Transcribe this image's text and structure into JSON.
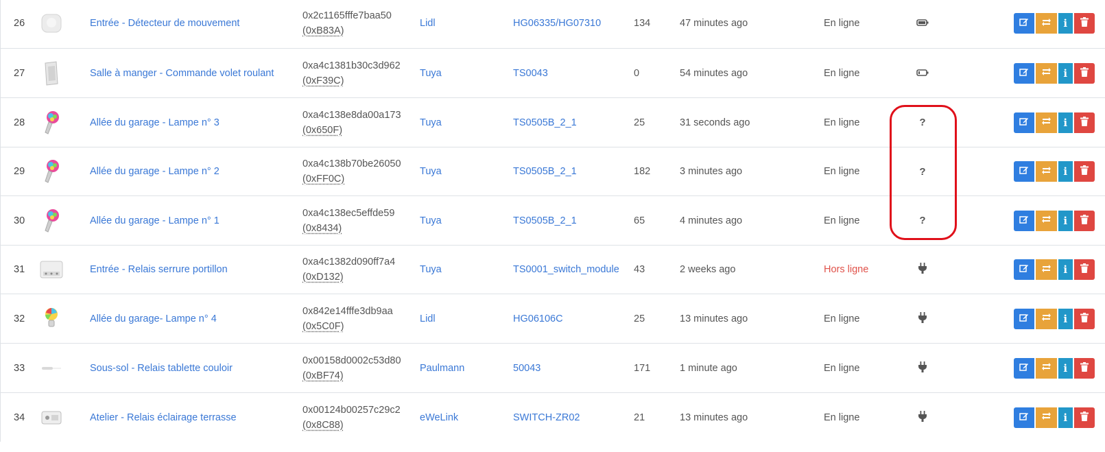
{
  "devices": [
    {
      "num": "26",
      "image": "motion-sensor-image",
      "name": "Entrée - Détecteur de mouvement",
      "ieee": "0x2c1165fffe7baa50",
      "nwk": "(0xB83A)",
      "manufacturer": "Lidl",
      "model": "HG06335/HG07310",
      "lqi": "134",
      "last_seen": "47 minutes ago",
      "availability": "En ligne",
      "power": "battery-icon"
    },
    {
      "num": "27",
      "image": "shutter-switch-image",
      "name": "Salle à manger - Commande volet roulant",
      "ieee": "0xa4c1381b30c3d962",
      "nwk": "(0xF39C)",
      "manufacturer": "Tuya",
      "model": "TS0043",
      "lqi": "0",
      "last_seen": "54 minutes ago",
      "availability": "En ligne",
      "power": "battery-low-icon"
    },
    {
      "num": "28",
      "image": "bulb-image",
      "name": "Allée du garage - Lampe n° 3",
      "ieee": "0xa4c138e8da00a173",
      "nwk": "(0x650F)",
      "manufacturer": "Tuya",
      "model": "TS0505B_2_1",
      "lqi": "25",
      "last_seen": "31 seconds ago",
      "availability": "En ligne",
      "power": "?"
    },
    {
      "num": "29",
      "image": "bulb-image",
      "name": "Allée du garage - Lampe n° 2",
      "ieee": "0xa4c138b70be26050",
      "nwk": "(0xFF0C)",
      "manufacturer": "Tuya",
      "model": "TS0505B_2_1",
      "lqi": "182",
      "last_seen": "3 minutes ago",
      "availability": "En ligne",
      "power": "?"
    },
    {
      "num": "30",
      "image": "bulb-image",
      "name": "Allée du garage - Lampe n° 1",
      "ieee": "0xa4c138ec5effde59",
      "nwk": "(0x8434)",
      "manufacturer": "Tuya",
      "model": "TS0505B_2_1",
      "lqi": "65",
      "last_seen": "4 minutes ago",
      "availability": "En ligne",
      "power": "?"
    },
    {
      "num": "31",
      "image": "relay-module-image",
      "name": "Entrée - Relais serrure portillon",
      "ieee": "0xa4c1382d090ff7a4",
      "nwk": "(0xD132)",
      "manufacturer": "Tuya",
      "model": "TS0001_switch_module",
      "lqi": "43",
      "last_seen": "2 weeks ago",
      "availability": "Hors ligne",
      "power": "plug-icon"
    },
    {
      "num": "32",
      "image": "color-bulb-image",
      "name": "Allée du garage- Lampe n° 4",
      "ieee": "0x842e14fffe3db9aa",
      "nwk": "(0x5C0F)",
      "manufacturer": "Lidl",
      "model": "HG06106C",
      "lqi": "25",
      "last_seen": "13 minutes ago",
      "availability": "En ligne",
      "power": "plug-icon"
    },
    {
      "num": "33",
      "image": "led-strip-controller-image",
      "name": "Sous-sol - Relais tablette couloir",
      "ieee": "0x00158d0002c53d80",
      "nwk": "(0xBF74)",
      "manufacturer": "Paulmann",
      "model": "50043",
      "lqi": "171",
      "last_seen": "1 minute ago",
      "availability": "En ligne",
      "power": "plug-icon"
    },
    {
      "num": "34",
      "image": "switch-module-image",
      "name": "Atelier - Relais éclairage terrasse",
      "ieee": "0x00124b00257c29c2",
      "nwk": "(0x8C88)",
      "manufacturer": "eWeLink",
      "model": "SWITCH-ZR02",
      "lqi": "21",
      "last_seen": "13 minutes ago",
      "availability": "En ligne",
      "power": "plug-icon"
    }
  ],
  "colors": {
    "link": "#3a78d6",
    "offline": "#e0524a",
    "edit_button": "#2f7ee0",
    "rename_button": "#e8a33a",
    "info_button": "#2297c9",
    "delete_button": "#df4741",
    "annotation": "#e0101a"
  }
}
